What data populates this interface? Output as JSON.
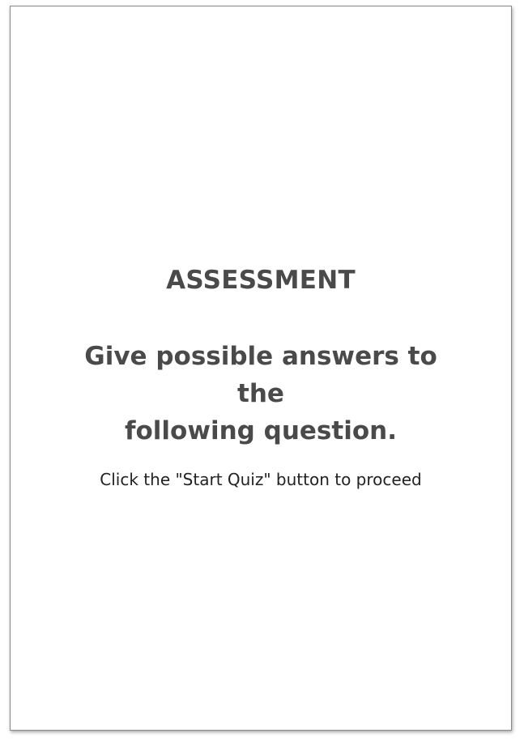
{
  "slide": {
    "heading": "ASSESSMENT",
    "question_line_1": "Give possible answers to the",
    "question_line_2": "following question.",
    "instruction": "Click the \"Start Quiz\" button to proceed"
  }
}
